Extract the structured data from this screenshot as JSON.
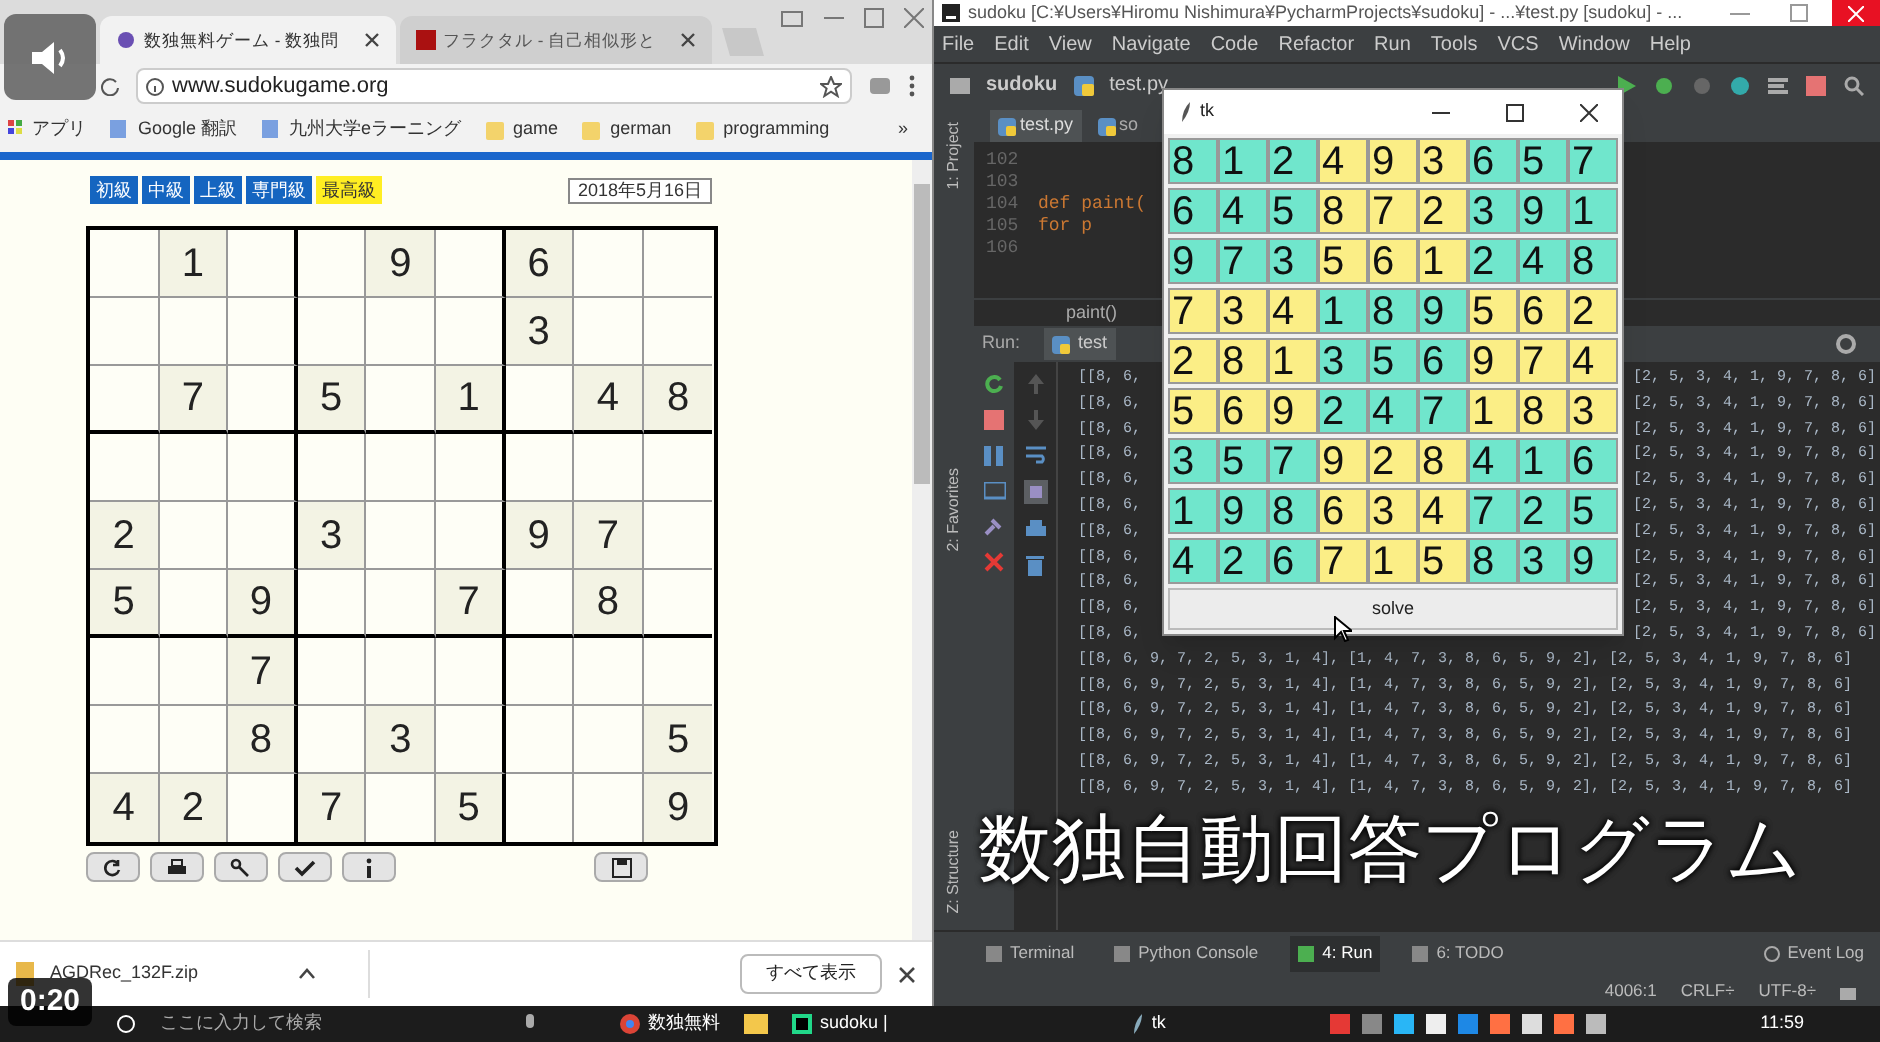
{
  "browser": {
    "tabs": [
      {
        "title": "数独無料ゲーム - 数独問",
        "selected": true
      },
      {
        "title": "フラクタル - 自己相似形と",
        "selected": false
      }
    ],
    "url": "www.sudokugame.org",
    "bookmarks": [
      {
        "label": "アプリ",
        "kind": "apps"
      },
      {
        "label": "Google 翻訳",
        "kind": "page"
      },
      {
        "label": "九州大学eラーニング",
        "kind": "page"
      },
      {
        "label": "game",
        "kind": "folder"
      },
      {
        "label": "german",
        "kind": "folder"
      },
      {
        "label": "programming",
        "kind": "folder"
      }
    ],
    "more": "»",
    "page": {
      "levels": [
        {
          "label": "初級",
          "selected": false
        },
        {
          "label": "中級",
          "selected": false
        },
        {
          "label": "上級",
          "selected": false
        },
        {
          "label": "専門級",
          "selected": false
        },
        {
          "label": "最高級",
          "selected": true
        }
      ],
      "date": "2018年5月16日",
      "grid": [
        [
          {
            "filled": false
          },
          {
            "filled": true,
            "digit": "1"
          },
          {
            "filled": false
          },
          {
            "filled": false
          },
          {
            "filled": true,
            "digit": "9"
          },
          {
            "filled": false
          },
          {
            "filled": true,
            "digit": "6"
          },
          {
            "filled": false
          },
          {
            "filled": false
          }
        ],
        [
          {
            "filled": false
          },
          {
            "filled": false
          },
          {
            "filled": false
          },
          {
            "filled": false
          },
          {
            "filled": false
          },
          {
            "filled": false
          },
          {
            "filled": true,
            "digit": "3"
          },
          {
            "filled": false
          },
          {
            "filled": false
          }
        ],
        [
          {
            "filled": false
          },
          {
            "filled": true,
            "digit": "7"
          },
          {
            "filled": false
          },
          {
            "filled": true,
            "digit": "5"
          },
          {
            "filled": false
          },
          {
            "filled": true,
            "digit": "1"
          },
          {
            "filled": false
          },
          {
            "filled": true,
            "digit": "4"
          },
          {
            "filled": true,
            "digit": "8"
          }
        ],
        [
          {
            "filled": false
          },
          {
            "filled": false
          },
          {
            "filled": false
          },
          {
            "filled": false
          },
          {
            "filled": false
          },
          {
            "filled": false
          },
          {
            "filled": false
          },
          {
            "filled": false
          },
          {
            "filled": false
          }
        ],
        [
          {
            "filled": true,
            "digit": "2"
          },
          {
            "filled": false
          },
          {
            "filled": false
          },
          {
            "filled": true,
            "digit": "3"
          },
          {
            "filled": false
          },
          {
            "filled": false
          },
          {
            "filled": true,
            "digit": "9"
          },
          {
            "filled": true,
            "digit": "7"
          },
          {
            "filled": false
          }
        ],
        [
          {
            "filled": true,
            "digit": "5"
          },
          {
            "filled": false
          },
          {
            "filled": true,
            "digit": "9"
          },
          {
            "filled": false
          },
          {
            "filled": false
          },
          {
            "filled": true,
            "digit": "7"
          },
          {
            "filled": false
          },
          {
            "filled": true,
            "digit": "8"
          },
          {
            "filled": false
          }
        ],
        [
          {
            "filled": false
          },
          {
            "filled": false
          },
          {
            "filled": true,
            "digit": "7"
          },
          {
            "filled": false
          },
          {
            "filled": false
          },
          {
            "filled": false
          },
          {
            "filled": false
          },
          {
            "filled": false
          },
          {
            "filled": false
          }
        ],
        [
          {
            "filled": false
          },
          {
            "filled": false
          },
          {
            "filled": true,
            "digit": "8"
          },
          {
            "filled": false
          },
          {
            "filled": true,
            "digit": "3"
          },
          {
            "filled": false
          },
          {
            "filled": false
          },
          {
            "filled": false
          },
          {
            "filled": true,
            "digit": "5"
          }
        ],
        [
          {
            "filled": true,
            "digit": "4"
          },
          {
            "filled": true,
            "digit": "2"
          },
          {
            "filled": false
          },
          {
            "filled": true,
            "digit": "7"
          },
          {
            "filled": false
          },
          {
            "filled": true,
            "digit": "5"
          },
          {
            "filled": false
          },
          {
            "filled": false
          },
          {
            "filled": true,
            "digit": "9"
          }
        ]
      ]
    },
    "download": {
      "file": "AGDRec_132F.zip",
      "show_all": "すべて表示"
    }
  },
  "ide": {
    "title": "sudoku [C:¥Users¥Hiromu Nishimura¥PycharmProjects¥sudoku] - ...¥test.py [sudoku] - ...",
    "menu": [
      "File",
      "Edit",
      "View",
      "Navigate",
      "Code",
      "Refactor",
      "Run",
      "Tools",
      "VCS",
      "Window",
      "Help"
    ],
    "breadcrumb": [
      "sudoku",
      "test.py"
    ],
    "editor_tabs": [
      {
        "label": "test.py",
        "selected": true
      },
      {
        "label": "so",
        "selected": false
      }
    ],
    "lines": [
      {
        "number": "102"
      },
      {
        "number": "103"
      },
      {
        "number": "104",
        "code": "def paint("
      },
      {
        "number": "105",
        "code": "for p"
      },
      {
        "number": "106"
      }
    ],
    "function_crumb": "paint()",
    "run_label": "Run:",
    "run_tab": "test",
    "console": [
      {
        "kind": "covered",
        "left": "[[8, 6,",
        "right": "[2, 5, 3, 4, 1, 9, 7, 8, 6]"
      },
      {
        "kind": "covered",
        "left": "[[8, 6,",
        "right": "[2, 5, 3, 4, 1, 9, 7, 8, 6]"
      },
      {
        "kind": "covered",
        "left": "[[8, 6,",
        "right": "[2, 5, 3, 4, 1, 9, 7, 8, 6]"
      },
      {
        "kind": "covered",
        "left": "[[8, 6,",
        "right": "[2, 5, 3, 4, 1, 9, 7, 8, 6]"
      },
      {
        "kind": "covered",
        "left": "[[8, 6,",
        "right": "[2, 5, 3, 4, 1, 9, 7, 8, 6]"
      },
      {
        "kind": "covered",
        "left": "[[8, 6,",
        "right": "[2, 5, 3, 4, 1, 9, 7, 8, 6]"
      },
      {
        "kind": "covered",
        "left": "[[8, 6,",
        "right": "[2, 5, 3, 4, 1, 9, 7, 8, 6]"
      },
      {
        "kind": "covered",
        "left": "[[8, 6,",
        "right": "[2, 5, 3, 4, 1, 9, 7, 8, 6]"
      },
      {
        "kind": "covered",
        "left": "[[8, 6,",
        "right": "[2, 5, 3, 4, 1, 9, 7, 8, 6]"
      },
      {
        "kind": "covered",
        "left": "[[8, 6,",
        "right": "[2, 5, 3, 4, 1, 9, 7, 8, 6]"
      },
      {
        "kind": "covered",
        "left": "[[8, 6,",
        "right": "[2, 5, 3, 4, 1, 9, 7, 8, 6]"
      },
      {
        "kind": "full",
        "text": "[[8, 6, 9, 7, 2, 5, 3, 1, 4], [1, 4, 7, 3, 8, 6, 5, 9, 2], [2, 5, 3, 4, 1, 9, 7, 8, 6]"
      },
      {
        "kind": "full",
        "text": "[[8, 6, 9, 7, 2, 5, 3, 1, 4], [1, 4, 7, 3, 8, 6, 5, 9, 2], [2, 5, 3, 4, 1, 9, 7, 8, 6]"
      },
      {
        "kind": "full",
        "text": "[[8, 6, 9, 7, 2, 5, 3, 1, 4], [1, 4, 7, 3, 8, 6, 5, 9, 2], [2, 5, 3, 4, 1, 9, 7, 8, 6]"
      },
      {
        "kind": "full",
        "text": "[[8, 6, 9, 7, 2, 5, 3, 1, 4], [1, 4, 7, 3, 8, 6, 5, 9, 2], [2, 5, 3, 4, 1, 9, 7, 8, 6]"
      },
      {
        "kind": "full",
        "text": "[[8, 6, 9, 7, 2, 5, 3, 1, 4], [1, 4, 7, 3, 8, 6, 5, 9, 2], [2, 5, 3, 4, 1, 9, 7, 8, 6]"
      },
      {
        "kind": "full",
        "text": "[[8, 6, 9, 7, 2, 5, 3, 1, 4], [1, 4, 7, 3, 8, 6, 5, 9, 2], [2, 5, 3, 4, 1, 9, 7, 8, 6]"
      }
    ],
    "side_tabs": [
      "1: Project",
      "2: Favorites",
      "Z: Structure"
    ],
    "bottom_tabs": [
      {
        "label": "Terminal",
        "selected": false
      },
      {
        "label": "Python Console",
        "selected": false
      },
      {
        "label": "4: Run",
        "selected": true
      },
      {
        "label": "6: TODO",
        "selected": false
      }
    ],
    "event_log": "Event Log",
    "status": [
      "4006:1",
      "CRLF÷",
      "UTF-8÷"
    ]
  },
  "tk": {
    "title": "tk",
    "rows": [
      [
        "8",
        "1",
        "2",
        "4",
        "9",
        "3",
        "6",
        "5",
        "7"
      ],
      [
        "6",
        "4",
        "5",
        "8",
        "7",
        "2",
        "3",
        "9",
        "1"
      ],
      [
        "9",
        "7",
        "3",
        "5",
        "6",
        "1",
        "2",
        "4",
        "8"
      ],
      [
        "7",
        "3",
        "4",
        "1",
        "8",
        "9",
        "5",
        "6",
        "2"
      ],
      [
        "2",
        "8",
        "1",
        "3",
        "5",
        "6",
        "9",
        "7",
        "4"
      ],
      [
        "5",
        "6",
        "9",
        "2",
        "4",
        "7",
        "1",
        "8",
        "3"
      ],
      [
        "3",
        "5",
        "7",
        "9",
        "2",
        "8",
        "4",
        "1",
        "6"
      ],
      [
        "1",
        "9",
        "8",
        "6",
        "3",
        "4",
        "7",
        "2",
        "5"
      ],
      [
        "4",
        "2",
        "6",
        "7",
        "1",
        "5",
        "8",
        "3",
        "9"
      ]
    ],
    "button": "solve"
  },
  "taskbar": {
    "search": "ここに入力して検索",
    "apps": [
      {
        "label": "数独無料",
        "kind": "chrome"
      },
      {
        "label": "sudoku |",
        "kind": "pycharm"
      }
    ],
    "tk_label": "tk",
    "clock": "11:59"
  },
  "video": {
    "time": "0:20",
    "caption": "数独自動回答プログラム"
  }
}
